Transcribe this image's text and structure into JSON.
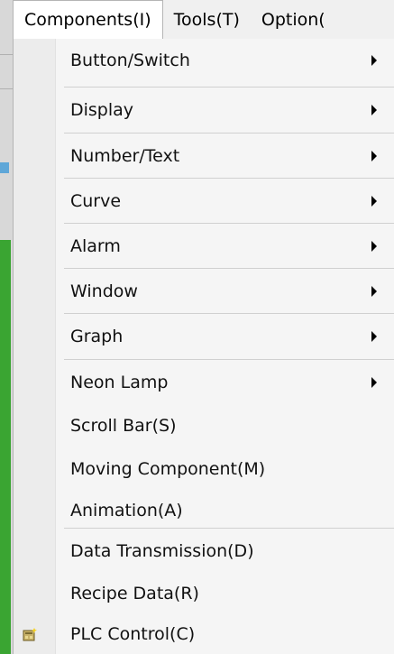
{
  "menubar": {
    "items": [
      {
        "label": "Components(I)",
        "underline_char": "I"
      },
      {
        "label": "Tools(T)",
        "underline_char": "T"
      },
      {
        "label": "Option(",
        "underline_char": ""
      }
    ]
  },
  "dropdown": {
    "items": [
      {
        "id": "button-switch",
        "label": "Button/Switch",
        "has_submenu": true
      },
      {
        "id": "display",
        "label": "Display",
        "has_submenu": true
      },
      {
        "id": "number-text",
        "label": "Number/Text",
        "has_submenu": true
      },
      {
        "id": "curve",
        "label": "Curve",
        "has_submenu": true
      },
      {
        "id": "alarm",
        "label": "Alarm",
        "has_submenu": true
      },
      {
        "id": "window",
        "label": "Window",
        "has_submenu": true
      },
      {
        "id": "graph",
        "label": "Graph",
        "has_submenu": true
      },
      {
        "id": "neon-lamp",
        "label": "Neon Lamp",
        "has_submenu": true
      },
      {
        "id": "scroll-bar",
        "label": "Scroll Bar(S)",
        "has_submenu": false
      },
      {
        "id": "moving-component",
        "label": "Moving Component(M)",
        "has_submenu": false
      },
      {
        "id": "animation",
        "label": "Animation(A)",
        "has_submenu": false
      },
      {
        "id": "data-transmission",
        "label": "Data Transmission(D)",
        "has_submenu": false
      },
      {
        "id": "recipe-data",
        "label": "Recipe Data(R)",
        "has_submenu": false
      },
      {
        "id": "plc-control",
        "label": "PLC Control(C)",
        "has_submenu": false,
        "icon": "plc-control-icon"
      }
    ]
  },
  "colors": {
    "menu_bg": "#f5f5f5",
    "gutter_bg": "#ececec",
    "separator": "#d0d0d0",
    "text": "#111111"
  }
}
